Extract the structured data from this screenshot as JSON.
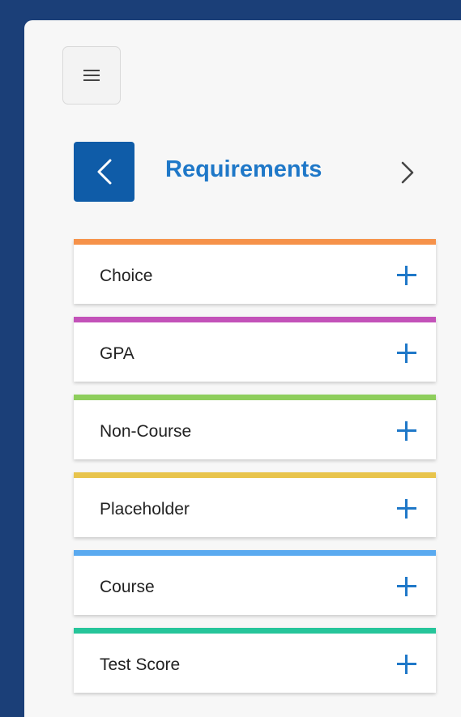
{
  "nav": {
    "title": "Requirements",
    "icons": {
      "menu": "hamburger-icon",
      "previous": "chevron-left-icon",
      "next": "chevron-right-icon"
    }
  },
  "requirements": [
    {
      "label": "Choice",
      "color": "#f6924a"
    },
    {
      "label": "GPA",
      "color": "#c352b9"
    },
    {
      "label": "Non-Course",
      "color": "#8ece5c"
    },
    {
      "label": "Placeholder",
      "color": "#e8c44c"
    },
    {
      "label": "Course",
      "color": "#5aaaf0"
    },
    {
      "label": "Test Score",
      "color": "#26c59a"
    }
  ],
  "colors": {
    "background": "#1b3f78",
    "panel": "#f7f7f7",
    "accent": "#1f78c8",
    "prev_button": "#0f5ca8"
  }
}
